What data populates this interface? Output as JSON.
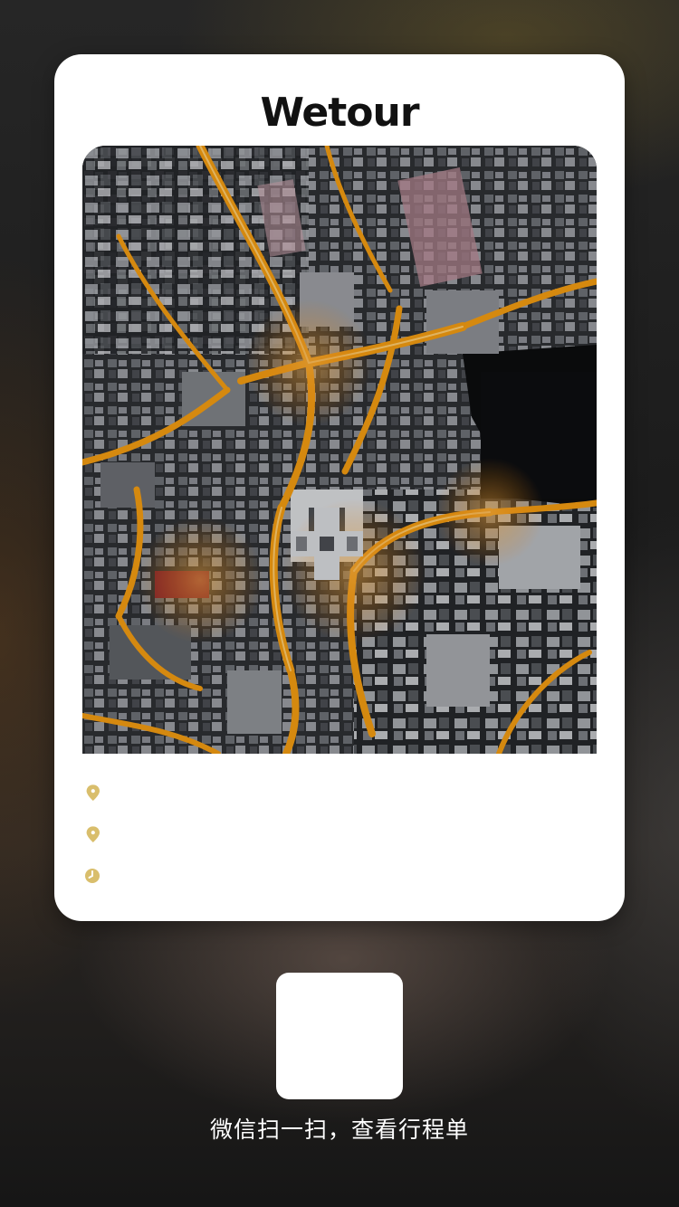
{
  "card": {
    "brand": "Wetour"
  },
  "info": {
    "rows": [
      {
        "icon": "location-pin-icon",
        "value": ""
      },
      {
        "icon": "location-pin-icon",
        "value": ""
      },
      {
        "icon": "clock-icon",
        "value": ""
      }
    ],
    "icon_color": "#D9BE6C"
  },
  "photo": {
    "subject": "aerial-night-city-photo"
  },
  "qr": {
    "icon": "qr-code-placeholder"
  },
  "footer": {
    "scan_hint": "微信扫一扫，查看行程单"
  },
  "colors": {
    "card_bg": "#FFFFFF",
    "accent": "#D9BE6C",
    "street_light": "#F5A623"
  }
}
